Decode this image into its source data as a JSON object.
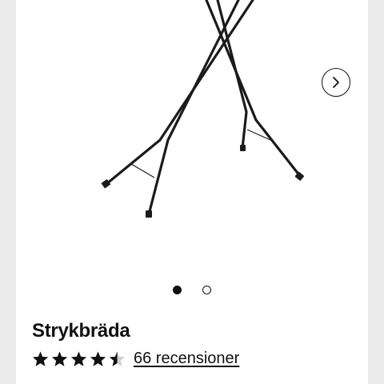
{
  "product": {
    "title": "Strykbräda",
    "rating": 4.5,
    "rating_max": 5,
    "reviews_label": "66 recensioner"
  },
  "gallery": {
    "image_icon": "ironing-board-legs",
    "next_icon": "chevron-right-icon",
    "dots": [
      {
        "active": true
      },
      {
        "active": false
      }
    ]
  },
  "colors": {
    "page_background": "#ebebeb",
    "card_background": "#ffffff",
    "primary": "#111111"
  }
}
